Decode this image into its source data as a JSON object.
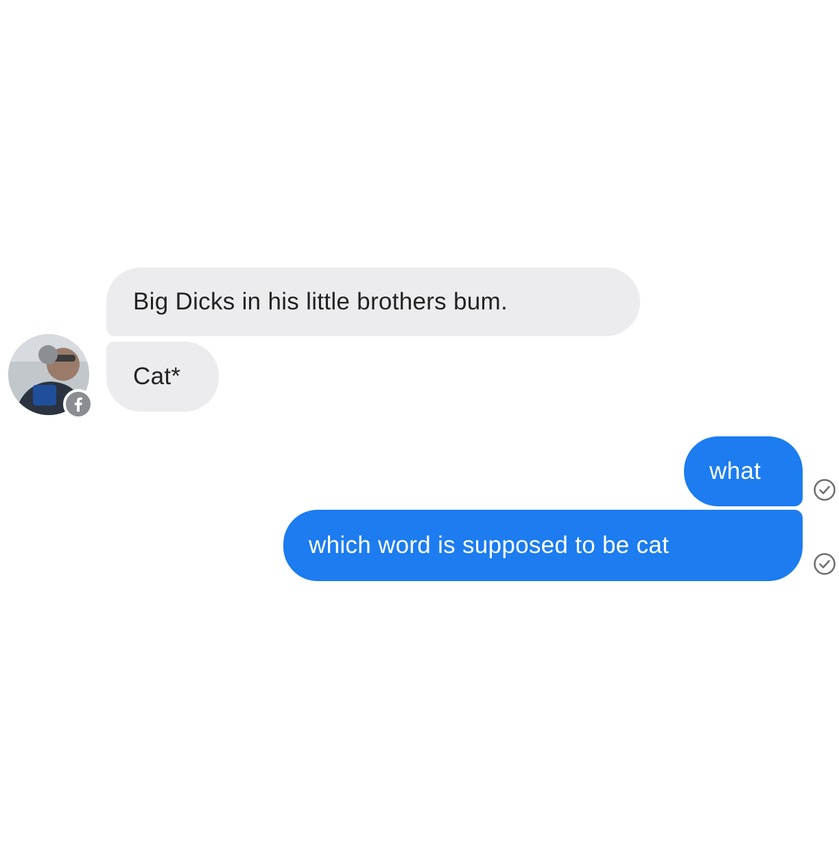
{
  "conversation": {
    "incoming": [
      {
        "text": "Big Dicks in his little brothers bum."
      },
      {
        "text": "Cat*"
      }
    ],
    "outgoing": [
      {
        "text": "what"
      },
      {
        "text": "which word is supposed to be cat"
      }
    ]
  },
  "icons": {
    "avatar": "user-avatar-photo",
    "badge": "facebook-icon",
    "receipt": "sent-check-icon"
  },
  "colors": {
    "incoming_bubble": "#ececee",
    "incoming_text": "#222222",
    "outgoing_bubble": "#1c7cf0",
    "outgoing_text": "#ffffff",
    "badge": "#8a8d91"
  }
}
